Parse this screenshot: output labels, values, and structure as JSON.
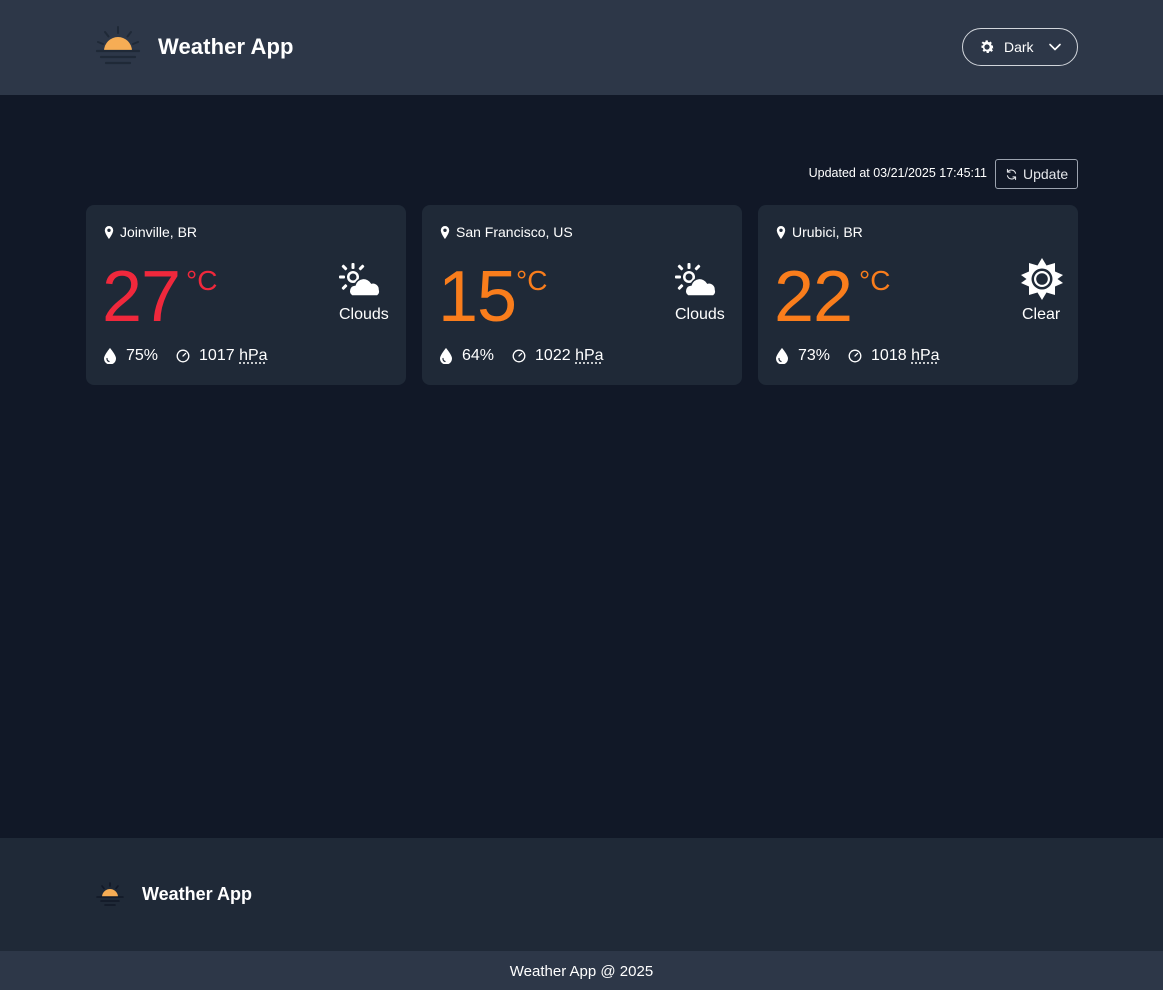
{
  "header": {
    "title": "Weather App",
    "logo_icon": "sunset-icon",
    "theme_selector": {
      "label": "Dark",
      "icon": "gear-icon",
      "caret": "chevron-down-icon"
    }
  },
  "toolbar": {
    "updated_text": "Updated at 03/21/2025 17:45:11",
    "update_label": "Update",
    "update_icon": "refresh-icon"
  },
  "cards": [
    {
      "location": "Joinville, BR",
      "temperature": "27",
      "unit": "°C",
      "temp_color": "#f0283c",
      "condition": "Clouds",
      "condition_icon": "partly-cloudy-icon",
      "humidity": "75%",
      "pressure_value": "1017",
      "pressure_unit": "hPa"
    },
    {
      "location": "San Francisco, US",
      "temperature": "15",
      "unit": "°C",
      "temp_color": "#f97d1c",
      "condition": "Clouds",
      "condition_icon": "partly-cloudy-icon",
      "humidity": "64%",
      "pressure_value": "1022",
      "pressure_unit": "hPa"
    },
    {
      "location": "Urubici, BR",
      "temperature": "22",
      "unit": "°C",
      "temp_color": "#f97d1c",
      "condition": "Clear",
      "condition_icon": "sun-icon",
      "humidity": "73%",
      "pressure_value": "1018",
      "pressure_unit": "hPa"
    }
  ],
  "footer": {
    "title": "Weather App",
    "copyright": "Weather App @ 2025"
  },
  "colors": {
    "header_bg": "#2d3748",
    "page_bg": "#111827",
    "card_bg": "#1f2937",
    "sun": "#f6ad55"
  }
}
